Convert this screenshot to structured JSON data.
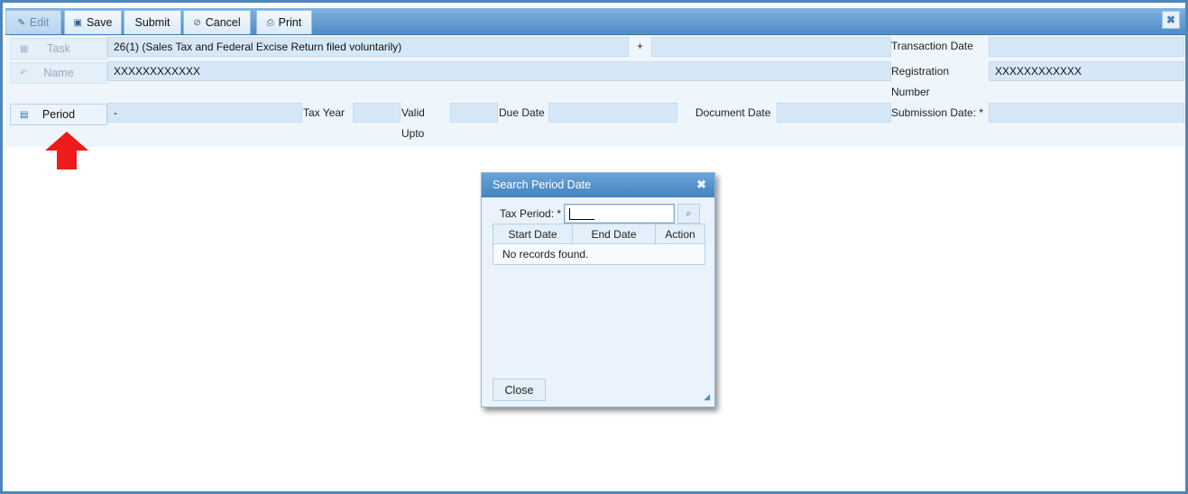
{
  "toolbar": {
    "edit_label": "Edit",
    "save_label": "Save",
    "submit_label": "Submit",
    "cancel_label": "Cancel",
    "print_label": "Print",
    "close_glyph": "✖"
  },
  "form": {
    "task_button": "Task",
    "task_value": "26(1) (Sales Tax and Federal Excise Return filed voluntarily)",
    "plus_label": "+",
    "transaction_date_label": "Transaction Date",
    "transaction_date_value": "",
    "name_button": "Name",
    "name_value": "XXXXXXXXXXXX",
    "registration_label_1": "Registration",
    "registration_label_2": "Number",
    "registration_value": "XXXXXXXXXXXX",
    "period_button": "Period",
    "period_value": "-",
    "tax_year_label": "Tax Year",
    "tax_year_value": "",
    "valid_upto_label_1": "Valid",
    "valid_upto_label_2": "Upto",
    "valid_upto_value": "",
    "due_date_label": "Due Date",
    "due_date_value": "",
    "document_date_label": "Document Date",
    "document_date_value": "",
    "submission_date_label": "Submission Date: *",
    "submission_date_value": ""
  },
  "dialog": {
    "title": "Search Period Date",
    "close_glyph": "✖",
    "tax_period_label": "Tax Period: *",
    "tax_period_value": "",
    "columns": [
      "Start Date",
      "End Date",
      "Action"
    ],
    "empty_message": "No records found.",
    "close_button": "Close"
  },
  "colors": {
    "toolbar": "#4f8dc8",
    "form_background": "#eef6fc",
    "field_fill": "#d6e8f7",
    "arrow": "#ee1b1b"
  },
  "icons": {
    "edit": "pencil-icon",
    "save": "save-icon",
    "cancel": "cancel-icon",
    "print": "print-icon",
    "task": "document-icon",
    "name": "undo-icon",
    "period": "calendar-icon",
    "search": "search-icon"
  }
}
